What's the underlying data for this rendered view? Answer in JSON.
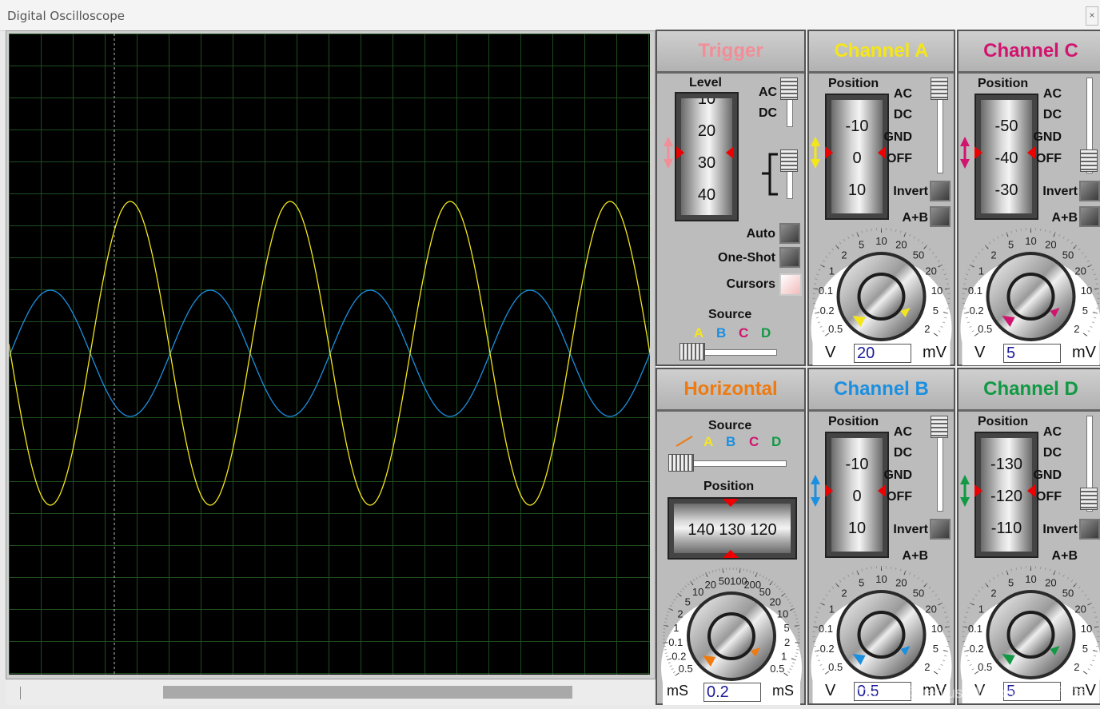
{
  "window": {
    "title": "Digital Oscilloscope",
    "close_label": "×"
  },
  "colors": {
    "channel_a": "#f5e61a",
    "channel_b": "#1b8fe0",
    "channel_c": "#d0156f",
    "channel_d": "#119944",
    "trigger": "#f28e97",
    "horizontal": "#ee7a10",
    "grid": "#1e4d1e"
  },
  "trigger": {
    "title": "Trigger",
    "level_label": "Level",
    "level_drum": [
      "10",
      "20",
      "30",
      "40"
    ],
    "ac_label": "AC",
    "dc_label": "DC",
    "auto_label": "Auto",
    "oneshot_label": "One-Shot",
    "cursors_label": "Cursors",
    "source_label": "Source",
    "source_letters": [
      "A",
      "B",
      "C",
      "D"
    ]
  },
  "horizontal": {
    "title": "Horizontal",
    "source_label": "Source",
    "source_letters": [
      "A",
      "B",
      "C",
      "D"
    ],
    "position_label": "Position",
    "position_drum": "140 130 120",
    "dial_ticks": [
      "0.5",
      "0.2",
      "0.1",
      "1",
      "2",
      "5",
      "10",
      "20",
      "50",
      "100",
      "200",
      "50",
      "20",
      "10",
      "5",
      "2",
      "1",
      "0.5"
    ],
    "value": "0.2",
    "unit_left": "mS",
    "unit_right": "mS"
  },
  "channel_a": {
    "title": "Channel A",
    "position_label": "Position",
    "position_drum": [
      "-10",
      "0",
      "10"
    ],
    "ac": "AC",
    "dc": "DC",
    "gnd": "GND",
    "off": "OFF",
    "invert": "Invert",
    "aplusb": "A+B",
    "dial_ticks": [
      "0.5",
      "0.2",
      "0.1",
      "1",
      "2",
      "5",
      "10",
      "20",
      "50",
      "20",
      "10",
      "5",
      "2"
    ],
    "value": "20",
    "unit_left": "V",
    "unit_right": "mV"
  },
  "channel_b": {
    "title": "Channel B",
    "position_label": "Position",
    "position_drum": [
      "-10",
      "0",
      "10"
    ],
    "ac": "AC",
    "dc": "DC",
    "gnd": "GND",
    "off": "OFF",
    "invert": "Invert",
    "aplusb": "A+B",
    "dial_ticks": [
      "0.5",
      "0.2",
      "0.1",
      "1",
      "2",
      "5",
      "10",
      "20",
      "50",
      "20",
      "10",
      "5",
      "2"
    ],
    "value": "0.5",
    "unit_left": "V",
    "unit_right": "mV"
  },
  "channel_c": {
    "title": "Channel C",
    "position_label": "Position",
    "position_drum": [
      "-50",
      "-40",
      "-30"
    ],
    "ac": "AC",
    "dc": "DC",
    "gnd": "GND",
    "off": "OFF",
    "invert": "Invert",
    "aplusb": "A+B",
    "dial_ticks": [
      "0.5",
      "0.2",
      "0.1",
      "1",
      "2",
      "5",
      "10",
      "20",
      "50",
      "20",
      "10",
      "5",
      "2"
    ],
    "value": "5",
    "unit_left": "V",
    "unit_right": "mV"
  },
  "channel_d": {
    "title": "Channel D",
    "position_label": "Position",
    "position_drum": [
      "-130",
      "-120",
      "-110"
    ],
    "ac": "AC",
    "dc": "DC",
    "gnd": "GND",
    "off": "OFF",
    "invert": "Invert",
    "aplusb": "A+B",
    "dial_ticks": [
      "0.5",
      "0.2",
      "0.1",
      "1",
      "2",
      "5",
      "10",
      "20",
      "50",
      "20",
      "10",
      "5",
      "2"
    ],
    "value": "5",
    "unit_left": "V",
    "unit_right": "mV"
  },
  "watermark": "CSDN @geniusNMRobot顶级专家"
}
